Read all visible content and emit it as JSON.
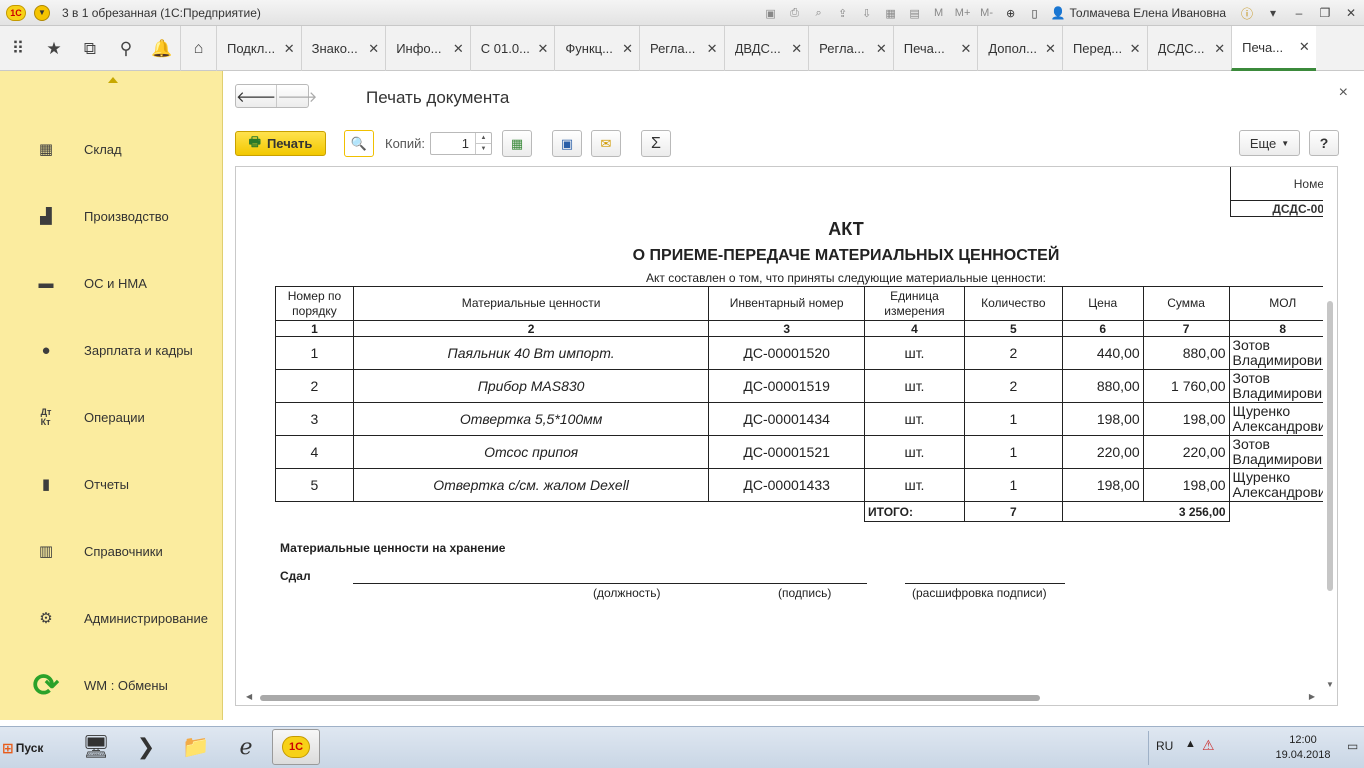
{
  "window": {
    "title": "3 в 1 обрезанная  (1С:Предприятие)",
    "user": "Толмачева Елена Ивановна",
    "tool_icons": [
      "save-icon",
      "print-icon",
      "preview-icon",
      "upload-icon",
      "download-icon",
      "calculator-icon",
      "calendar-icon"
    ],
    "mem_labels": [
      "M",
      "M+",
      "M-"
    ]
  },
  "tabs": [
    {
      "label": "Подкл..."
    },
    {
      "label": "Знако..."
    },
    {
      "label": "Инфо..."
    },
    {
      "label": "С 01.0..."
    },
    {
      "label": "Функц..."
    },
    {
      "label": "Регла..."
    },
    {
      "label": "ДВДС..."
    },
    {
      "label": "Регла..."
    },
    {
      "label": "Печа..."
    },
    {
      "label": "Допол..."
    },
    {
      "label": "Перед..."
    },
    {
      "label": "ДСДС..."
    },
    {
      "label": "Печа...",
      "active": true
    }
  ],
  "sidebar": {
    "items": [
      {
        "label": "Склад",
        "icon": "warehouse-icon"
      },
      {
        "label": "Производство",
        "icon": "factory-icon"
      },
      {
        "label": "ОС и НМА",
        "icon": "truck-icon"
      },
      {
        "label": "Зарплата и кадры",
        "icon": "person-icon"
      },
      {
        "label": "Операции",
        "icon": "debit-credit-icon"
      },
      {
        "label": "Отчеты",
        "icon": "bar-chart-icon"
      },
      {
        "label": "Справочники",
        "icon": "books-icon"
      },
      {
        "label": "Администрирование",
        "icon": "gear-icon"
      },
      {
        "label": "WM : Обмены",
        "icon": "sync-icon"
      }
    ]
  },
  "form": {
    "title": "Печать документа",
    "print_label": "Печать",
    "copies_label": "Копий:",
    "copies_value": "1",
    "more_label": "Еще",
    "help_label": "?"
  },
  "document": {
    "nomer_header": "Номе",
    "nomer_value": "ДСДС-00",
    "title": "АКТ",
    "subtitle": "О ПРИЕМЕ-ПЕРЕДАЧЕ МАТЕРИАЛЬНЫХ ЦЕННОСТЕЙ",
    "description": "Акт составлен о том, что приняты следующие материальные ценности:",
    "columns": [
      "Номер по порядку",
      "Материальные ценности",
      "Инвентарный номер",
      "Единица измерения",
      "Количество",
      "Цена",
      "Сумма",
      "МОЛ"
    ],
    "column_numbers": [
      "1",
      "2",
      "3",
      "4",
      "5",
      "6",
      "7",
      "8"
    ],
    "rows": [
      {
        "n": "1",
        "name": "Паяльник 40 Вт импорт.",
        "inv": "ДС-00001520",
        "unit": "шт.",
        "qty": "2",
        "price": "440,00",
        "sum": "880,00",
        "mol": "Зотов Владимирович"
      },
      {
        "n": "2",
        "name": "Прибор MAS830",
        "inv": "ДС-00001519",
        "unit": "шт.",
        "qty": "2",
        "price": "880,00",
        "sum": "1 760,00",
        "mol": "Зотов Владимирович"
      },
      {
        "n": "3",
        "name": "Отвертка  5,5*100мм",
        "inv": "ДС-00001434",
        "unit": "шт.",
        "qty": "1",
        "price": "198,00",
        "sum": "198,00",
        "mol": "Щуренко Александрович"
      },
      {
        "n": "4",
        "name": "Отсос припоя",
        "inv": "ДС-00001521",
        "unit": "шт.",
        "qty": "1",
        "price": "220,00",
        "sum": "220,00",
        "mol": "Зотов Владимирович"
      },
      {
        "n": "5",
        "name": "Отвертка с/см. жалом Dexell",
        "inv": "ДС-00001433",
        "unit": "шт.",
        "qty": "1",
        "price": "198,00",
        "sum": "198,00",
        "mol": "Щуренко Александрович"
      }
    ],
    "total_label": "ИТОГО:",
    "total_qty": "7",
    "total_sum": "3 256,00",
    "storage_label": "Материальные ценности на хранение",
    "sdal_label": "Сдал",
    "cap_position": "(должность)",
    "cap_signature": "(подпись)",
    "cap_decode": "(расшифровка подписи)"
  },
  "taskbar": {
    "start_label": "Пуск",
    "lang": "RU",
    "time": "12:00",
    "date": "19.04.2018"
  }
}
